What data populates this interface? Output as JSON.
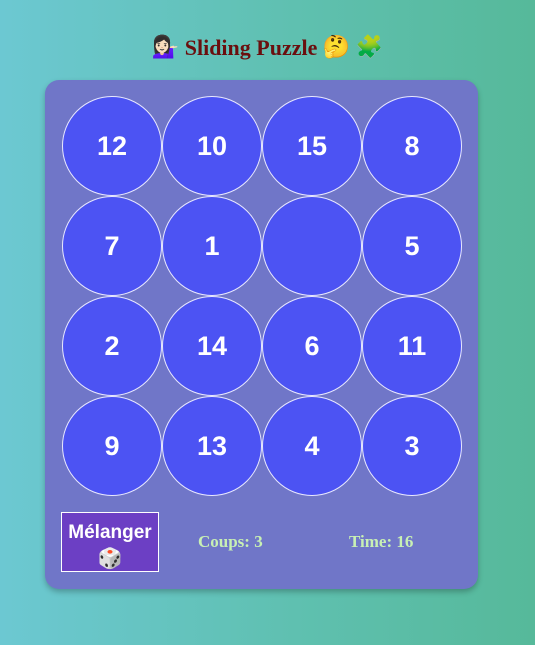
{
  "header": {
    "emoji_left": "💁🏻‍♀️",
    "title": "Sliding Puzzle",
    "emoji_thinking": "🤔",
    "emoji_puzzle": "🧩"
  },
  "board": {
    "rows": [
      [
        "12",
        "10",
        "15",
        "8"
      ],
      [
        "7",
        "1",
        "",
        "5"
      ],
      [
        "2",
        "14",
        "6",
        "11"
      ],
      [
        "9",
        "13",
        "4",
        "3"
      ]
    ],
    "tile_color": "#4c53f3",
    "card_color": "#7076c8"
  },
  "controls": {
    "shuffle_label": "Mélanger",
    "shuffle_icon": "🎲",
    "moves_text": "Coups: 3",
    "time_text": "Time: 16"
  }
}
